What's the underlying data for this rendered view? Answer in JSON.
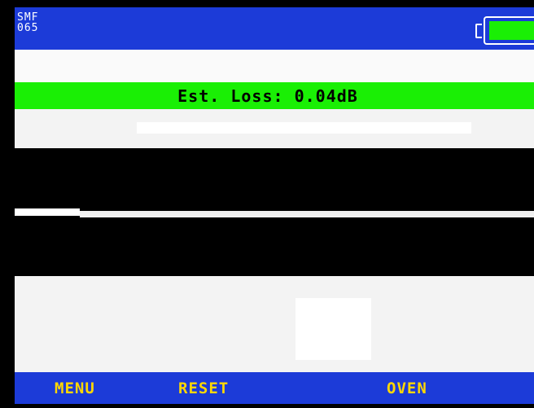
{
  "header": {
    "fiber_type_line1": "SMF",
    "fiber_type_line2": "065",
    "battery_icon": "battery-icon",
    "battery_level": 1.0
  },
  "measurement": {
    "loss_text": "Est. Loss: 0.04dB"
  },
  "softkeys": {
    "menu": "MENU",
    "reset": "RESET",
    "oven": "OVEN"
  },
  "colors": {
    "header_bar": "#1c3bd8",
    "loss_bar": "#1aef05",
    "battery_fill": "#1aef05",
    "softkey_text": "#ffd700"
  }
}
